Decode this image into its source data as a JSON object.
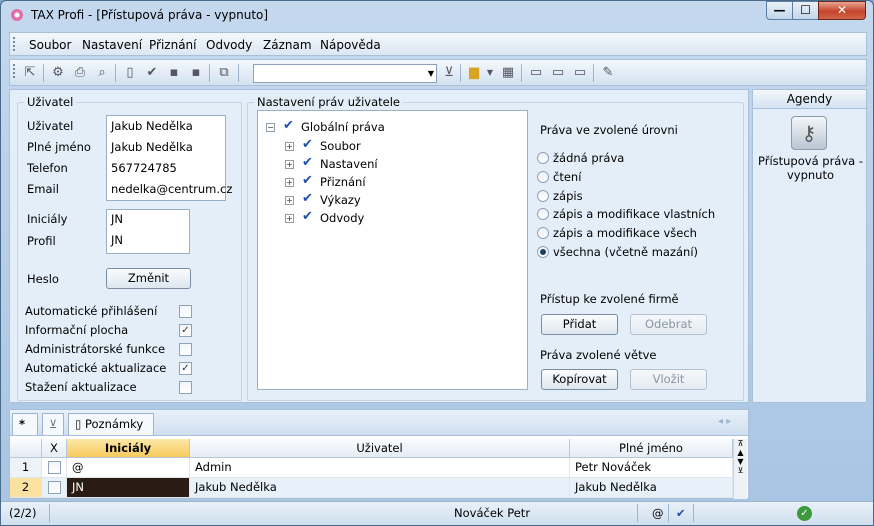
{
  "window": {
    "title": "TAX Profi - [Přístupová práva - vypnuto]",
    "min": "—",
    "max": "☐",
    "close": "✕"
  },
  "menu": [
    "Soubor",
    "Nastavení",
    "Přiznání",
    "Odvody",
    "Záznam",
    "Nápověda"
  ],
  "user_section": {
    "legend": "Uživatel",
    "fields": [
      {
        "label": "Uživatel",
        "value": "Jakub Nedělka"
      },
      {
        "label": "Plné jméno",
        "value": "Jakub Nedělka"
      },
      {
        "label": "Telefon",
        "value": "567724785"
      },
      {
        "label": "Email",
        "value": "nedelka@centrum.cz"
      }
    ],
    "initials_label": "Iniciály",
    "initials_value": "JN",
    "profile_label": "Profil",
    "profile_value": "JN",
    "password_label": "Heslo",
    "password_button": "Změnit",
    "checks": [
      {
        "label": "Automatické přihlášení",
        "checked": false
      },
      {
        "label": "Informační plocha",
        "checked": true
      },
      {
        "label": "Administrátorské funkce",
        "checked": false
      },
      {
        "label": "Automatické aktualizace",
        "checked": true
      },
      {
        "label": "Stažení aktualizace",
        "checked": false
      }
    ],
    "check_mark": "✓"
  },
  "rights_section": {
    "legend": "Nastavení práv uživatele",
    "tree_root": "Globální práva",
    "tree_children": [
      "Soubor",
      "Nastavení",
      "Přiznání",
      "Výkazy",
      "Odvody"
    ],
    "level_title": "Práva ve zvolené úrovni",
    "levels": [
      "žádná práva",
      "čtení",
      "zápis",
      "zápis a modifikace vlastních",
      "zápis a modifikace všech",
      "všechna (včetně mazání)"
    ],
    "selected_level": "všechna (včetně mazání)",
    "firm_title": "Přístup ke zvolené firmě",
    "add_button": "Přidat",
    "remove_button": "Odebrat",
    "branch_title": "Práva zvolené větve",
    "copy_button": "Kopírovat",
    "paste_button": "Vložit"
  },
  "agendy": {
    "title": "Agendy",
    "item": "Přístupová práva - vypnuto"
  },
  "bottom": {
    "tab_star": "*",
    "tab_notes": "Poznámky",
    "columns": [
      "X",
      "Iniciály",
      "Uživatel",
      "Plné jméno"
    ],
    "rows": [
      {
        "num": "1",
        "initials": "@",
        "user": "Admin",
        "full": "Petr Nováček"
      },
      {
        "num": "2",
        "initials": "JN",
        "user": "Jakub Nedělka",
        "full": "Jakub Nedělka"
      }
    ]
  },
  "status": {
    "count": "(2/2)",
    "user": "Nováček Petr",
    "at": "@"
  }
}
